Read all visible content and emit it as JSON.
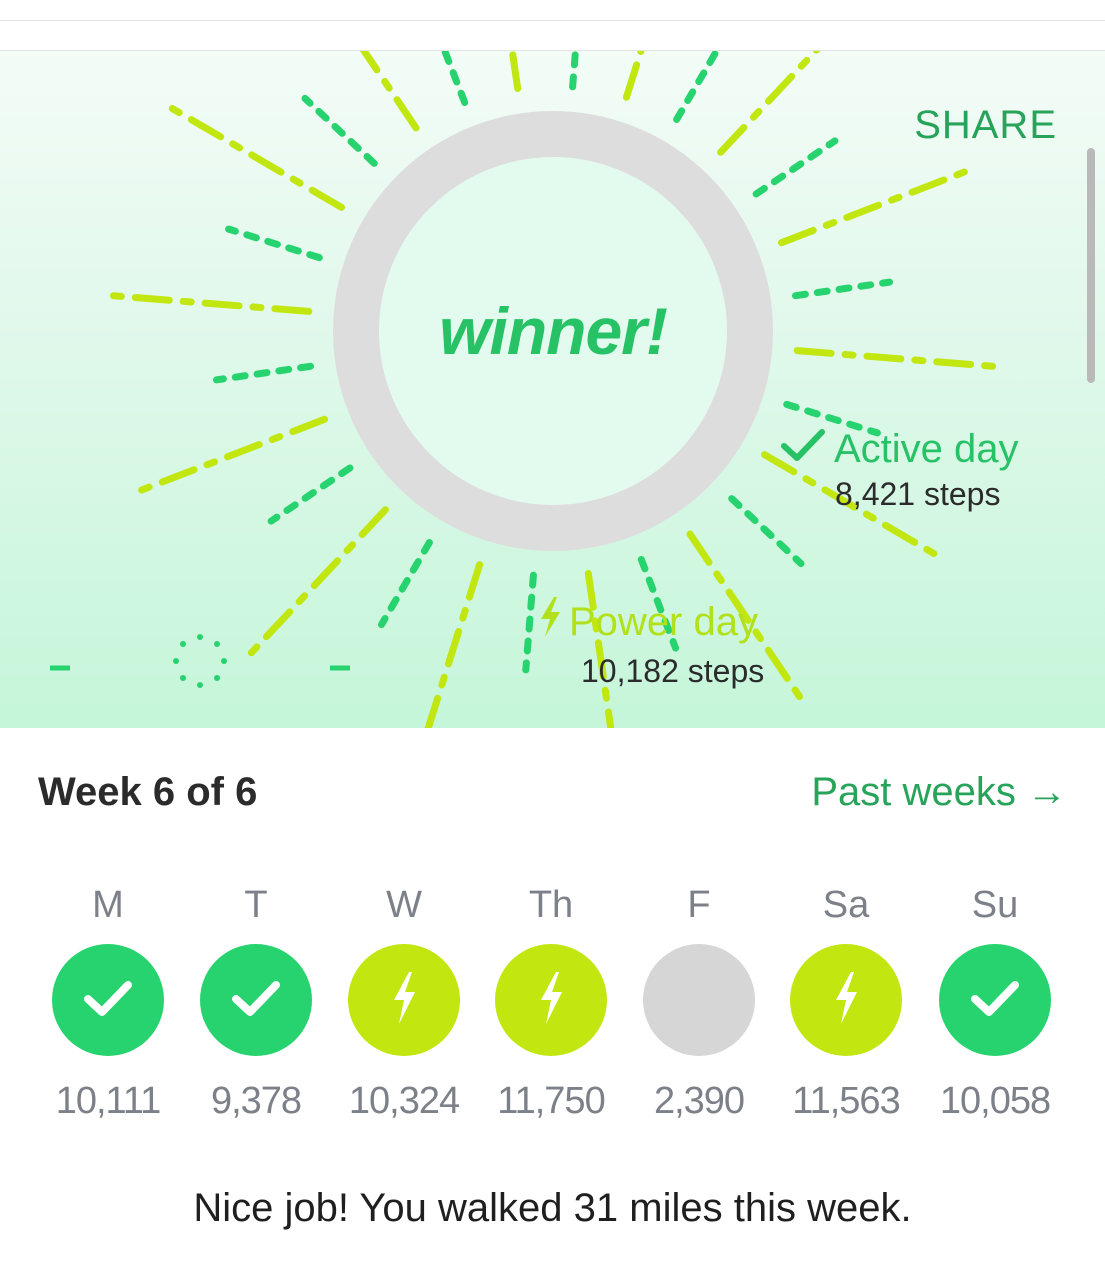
{
  "header": {
    "share_label": "SHARE"
  },
  "hero": {
    "badge_text": "winner!",
    "active_day": {
      "label": "Active day",
      "steps": "8,421 steps"
    },
    "power_day": {
      "label": "Power day",
      "steps": "10,182 steps"
    }
  },
  "week": {
    "title": "Week 6 of 6",
    "past_weeks_label": "Past weeks →",
    "days": [
      {
        "label": "M",
        "status": "active",
        "steps": "10,111"
      },
      {
        "label": "T",
        "status": "active",
        "steps": "9,378"
      },
      {
        "label": "W",
        "status": "power",
        "steps": "10,324"
      },
      {
        "label": "Th",
        "status": "power",
        "steps": "11,750"
      },
      {
        "label": "F",
        "status": "none",
        "steps": "2,390"
      },
      {
        "label": "Sa",
        "status": "power",
        "steps": "11,563"
      },
      {
        "label": "Su",
        "status": "active",
        "steps": "10,058"
      }
    ]
  },
  "summary": "Nice job! You walked 31 miles this week.",
  "colors": {
    "active_green": "#27d36e",
    "power_lime": "#c2e60f",
    "inactive_gray": "#d6d6d6",
    "text_green": "#27a35a"
  }
}
